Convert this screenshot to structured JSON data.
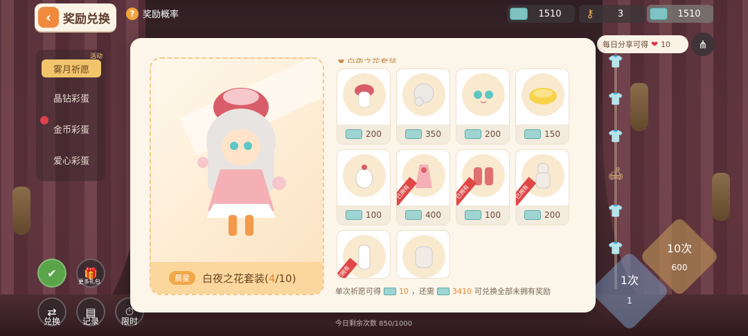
{
  "header": {
    "back_label": "奖励兑换",
    "prob_label": "奖励概率"
  },
  "currency": [
    {
      "icon": "ticket-icon",
      "value": "1510"
    },
    {
      "icon": "key-icon",
      "value": "3"
    },
    {
      "icon": "ticket-icon",
      "value": "1510"
    }
  ],
  "side": {
    "tag": "活动",
    "items": [
      "雾月祈愿",
      "晶钻彩蛋",
      "金币彩蛋",
      "爱心彩蛋"
    ]
  },
  "bottom_buttons": [
    {
      "label": "兑换"
    },
    {
      "label": "记录"
    },
    {
      "label": "限时"
    }
  ],
  "bottom_small": [
    "更多礼包"
  ],
  "today": "今日剩余次数 850/1000",
  "share": {
    "text": "每日分享可得",
    "count": "10"
  },
  "draw": {
    "ten_label": "10次",
    "ten_cost": "600",
    "one_label": "1次",
    "one_cost": "1"
  },
  "modal": {
    "grid_title": "白夜之花套装",
    "set": {
      "rarity": "晨星",
      "name": "白夜之花套装",
      "owned": "4",
      "total": "10"
    },
    "items": [
      {
        "price": "200",
        "owned": false
      },
      {
        "price": "350",
        "owned": false
      },
      {
        "price": "200",
        "owned": false
      },
      {
        "price": "150",
        "owned": false
      },
      {
        "price": "100",
        "owned": false
      },
      {
        "price": "400",
        "owned": true
      },
      {
        "price": "100",
        "owned": true
      },
      {
        "price": "200",
        "owned": true
      },
      {
        "price": "",
        "owned": true
      },
      {
        "price": "",
        "owned": false
      }
    ],
    "owned_label": "已拥有",
    "footer": {
      "prefix": "单次祈愿可得",
      "gain": "10",
      "mid": "，还需",
      "need": "3410",
      "suffix": "可兑换全部未拥有奖励"
    }
  }
}
